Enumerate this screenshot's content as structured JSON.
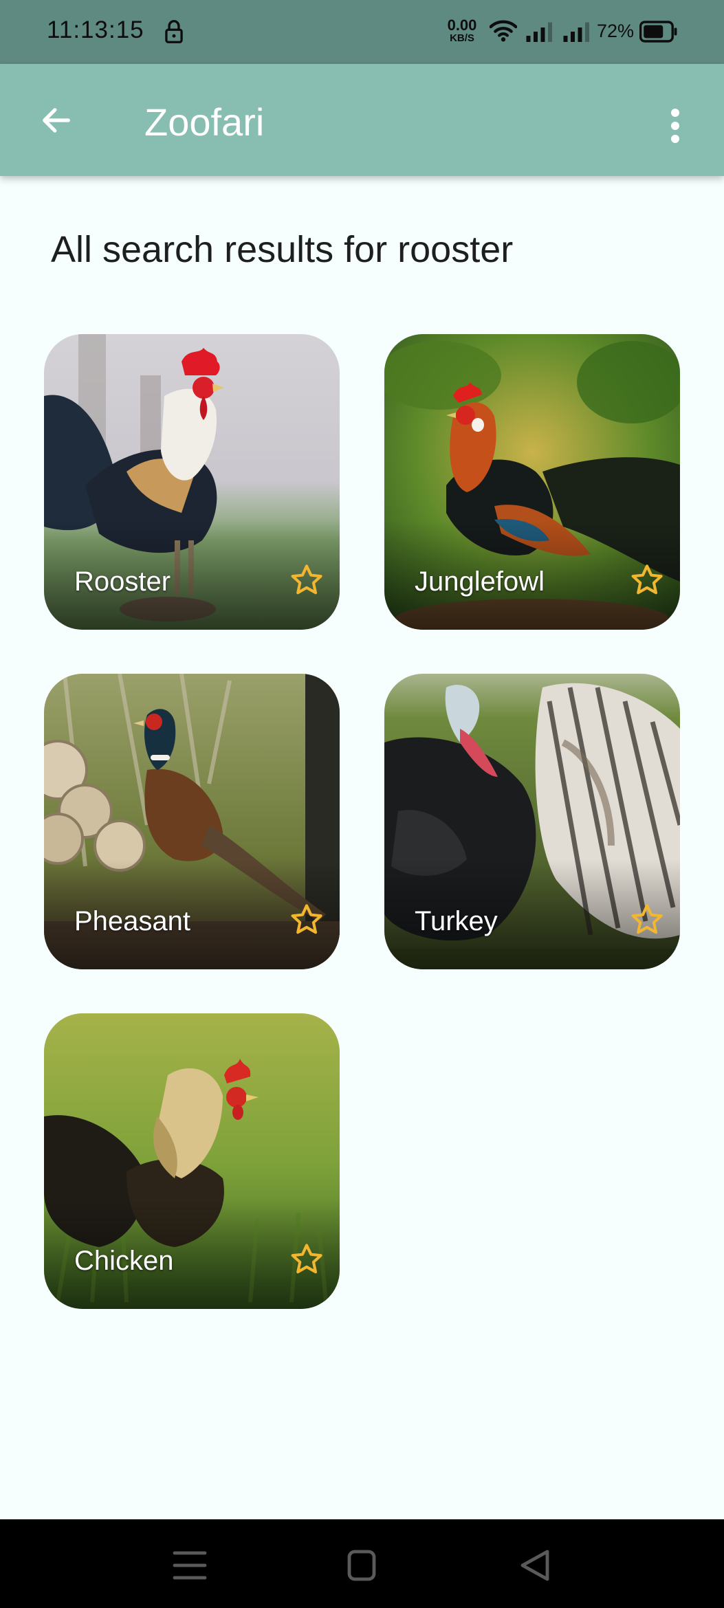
{
  "status_bar": {
    "time": "11:13:15",
    "speed_value": "0.00",
    "speed_unit": "KB/S",
    "battery_percent": "72%",
    "icons": [
      "lock-icon",
      "wifi-icon",
      "signal-icon",
      "signal-icon",
      "battery-icon"
    ]
  },
  "app_bar": {
    "title": "Zoofari",
    "back_icon": "arrow-left-icon",
    "menu_icon": "more-vert-icon"
  },
  "search": {
    "heading": "All search results for rooster"
  },
  "results": [
    {
      "name": "Rooster",
      "favorite_icon": "star-outline-icon"
    },
    {
      "name": "Junglefowl",
      "favorite_icon": "star-outline-icon"
    },
    {
      "name": "Pheasant",
      "favorite_icon": "star-outline-icon"
    },
    {
      "name": "Turkey",
      "favorite_icon": "star-outline-icon"
    },
    {
      "name": "Chicken",
      "favorite_icon": "star-outline-icon"
    }
  ],
  "nav_bar": {
    "icons": [
      "menu-icon",
      "home-square-icon",
      "back-triangle-icon"
    ]
  },
  "colors": {
    "status_bar": "#5f8a82",
    "app_bar": "#88bdb2",
    "background": "#f6fffd",
    "star": "#f2b630",
    "nav_bar": "#000000"
  }
}
